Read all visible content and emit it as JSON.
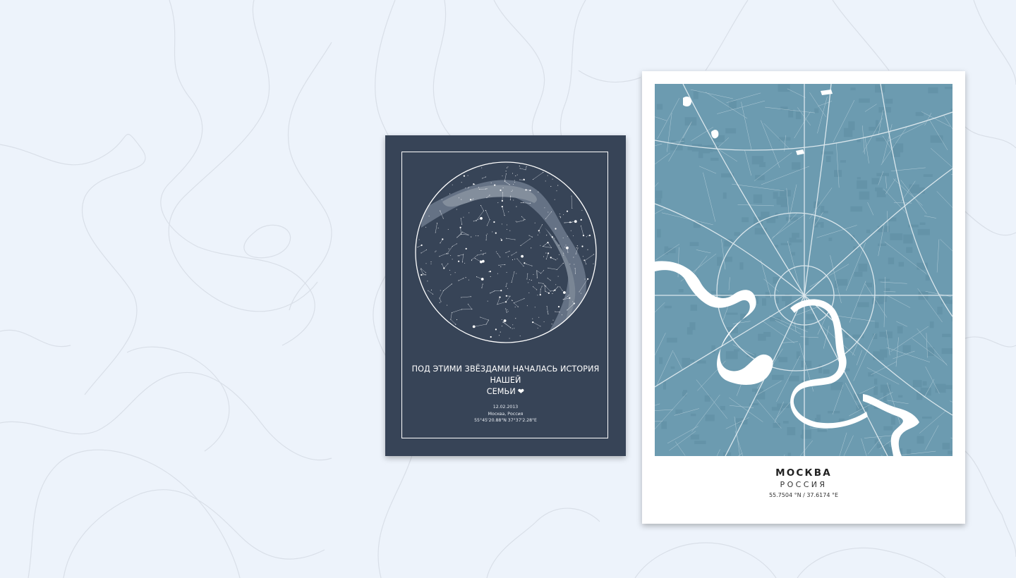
{
  "colors": {
    "background": "#edf3fb",
    "contour_lines": "#d9dfe8",
    "star_poster_bg": "#374457",
    "city_map_water": "#6c9bb0",
    "city_map_roads": "#ffffff"
  },
  "star_poster": {
    "caption_line1": "ПОД ЭТИМИ ЗВЁЗДАМИ НАЧАЛАСЬ ИСТОРИЯ НАШЕЙ",
    "caption_line2": "СЕМЬИ",
    "heart": "❤",
    "date": "12.02.2013",
    "place": "Москва, Россия",
    "coordinates": "55°45'20.88\"N 37°37'2.28\"E"
  },
  "city_poster": {
    "city": "МОСКВА",
    "country": "РОССИЯ",
    "coordinates": "55.7504 °N / 37.6174 °E"
  }
}
